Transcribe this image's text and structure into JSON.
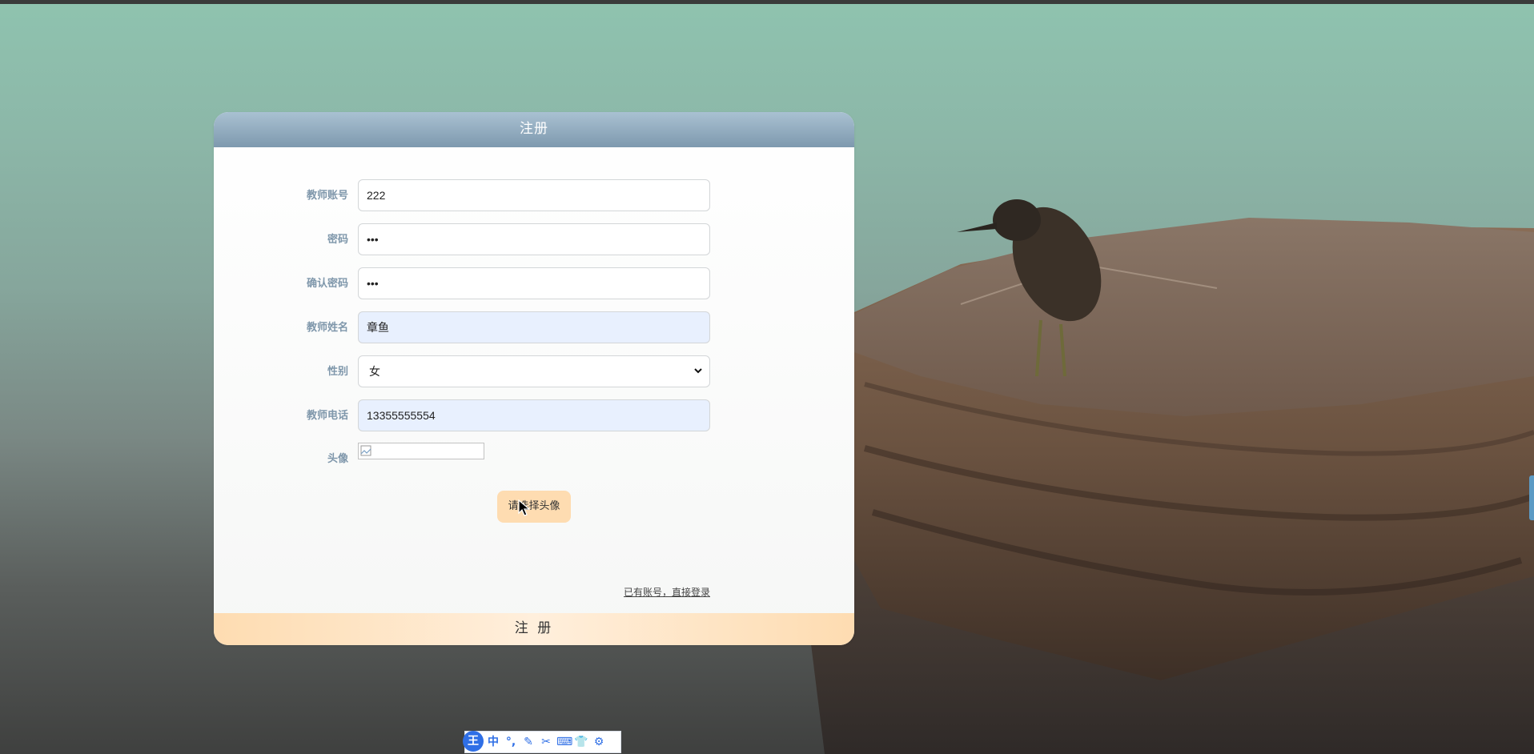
{
  "form": {
    "title": "注册",
    "fields": {
      "account": {
        "label": "教师账号",
        "value": "222"
      },
      "password": {
        "label": "密码",
        "value": "•••"
      },
      "confirm": {
        "label": "确认密码",
        "value": "•••"
      },
      "name": {
        "label": "教师姓名",
        "value": "章鱼"
      },
      "gender": {
        "label": "性别",
        "value": "女"
      },
      "phone": {
        "label": "教师电话",
        "value": "13355555554"
      },
      "avatar": {
        "label": "头像"
      }
    },
    "choose_avatar_label": "请选择头像",
    "login_link": "已有账号，直接登录",
    "submit_label": "注 册"
  },
  "ime_toolbar": {
    "logo": "王",
    "items": [
      {
        "icon": "chinese-mode-icon",
        "glyph": "中"
      },
      {
        "icon": "punctuation-icon",
        "glyph": "°,"
      },
      {
        "icon": "handwriting-icon",
        "glyph": "✎"
      },
      {
        "icon": "scissors-icon",
        "glyph": "✂"
      },
      {
        "icon": "keyboard-icon",
        "glyph": "⌨"
      },
      {
        "icon": "skin-icon",
        "glyph": "👕"
      },
      {
        "icon": "settings-gear-icon",
        "glyph": "⚙"
      }
    ]
  },
  "colors": {
    "header": "#8aa4b8",
    "label": "#7f97ab",
    "accent_peach": "#fedcb1",
    "autofill": "#e8f0fe"
  }
}
